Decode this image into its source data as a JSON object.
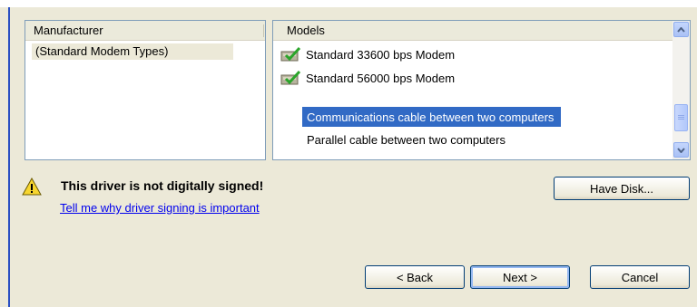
{
  "manufacturer_list": {
    "header": "Manufacturer",
    "items": [
      "(Standard Modem Types)"
    ]
  },
  "models_list": {
    "header": "Models",
    "items": [
      {
        "label": "Standard 33600 bps Modem",
        "icon": "modem-checkmark-icon"
      },
      {
        "label": "Standard 56000 bps Modem",
        "icon": "modem-checkmark-icon"
      },
      {
        "label": "Communications cable between two computers",
        "icon": "",
        "selected": true
      },
      {
        "label": "Parallel cable between two computers",
        "icon": ""
      }
    ]
  },
  "warning": {
    "icon": "warning-triangle-icon",
    "title": "This driver is not digitally signed!",
    "link": "Tell me why driver signing is important"
  },
  "buttons": {
    "have_disk": "Have Disk...",
    "back": "< Back",
    "next": "Next >",
    "cancel": "Cancel"
  },
  "colors": {
    "dialog_bg": "#ece9d8",
    "selection": "#316ac5",
    "link": "#0000ee",
    "frame_accent": "#2a4fc2"
  }
}
